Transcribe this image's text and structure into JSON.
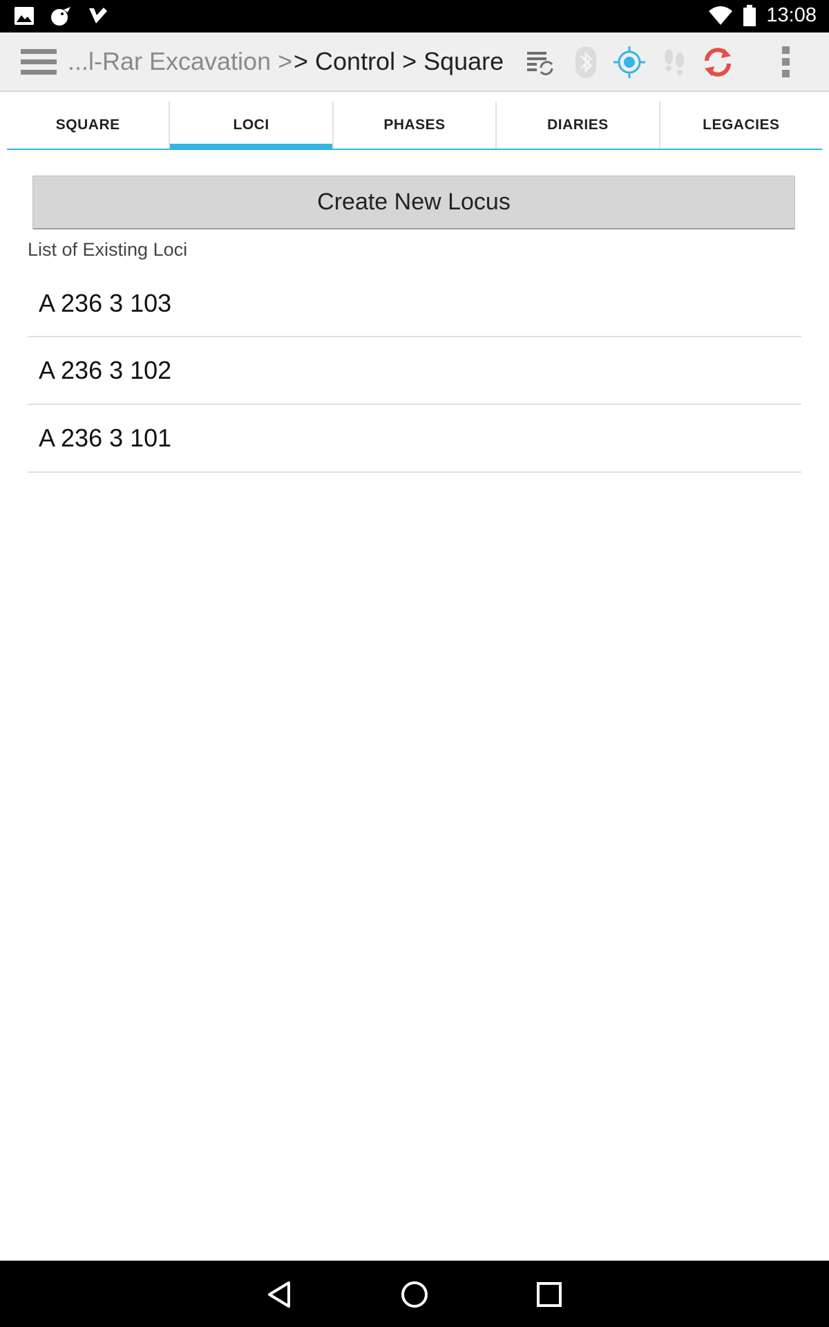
{
  "status_bar": {
    "time": "13:08",
    "left_icons": [
      "image-icon",
      "bird-icon",
      "check-icon"
    ],
    "right_icons": [
      "wifi-icon",
      "battery-icon"
    ]
  },
  "action_bar": {
    "breadcrumb_muted": "...l-Rar Excavation >",
    "breadcrumb_main": "> Control > Square",
    "icons": [
      "hamburger-icon",
      "sync-list-icon",
      "bluetooth-icon",
      "gps-icon",
      "footsteps-icon",
      "refresh-icon",
      "overflow-menu-icon"
    ]
  },
  "tabs": [
    {
      "label": "SQUARE",
      "active": false
    },
    {
      "label": "LOCI",
      "active": true
    },
    {
      "label": "PHASES",
      "active": false
    },
    {
      "label": "DIARIES",
      "active": false
    },
    {
      "label": "LEGACIES",
      "active": false
    }
  ],
  "main": {
    "create_button_label": "Create New Locus",
    "list_label": "List of Existing Loci",
    "loci": [
      "A 236 3 103",
      "A 236 3 102",
      "A 236 3 101"
    ]
  },
  "colors": {
    "accent": "#33b5e5",
    "refresh": "#e0504a",
    "status_bar": "#000000",
    "action_bar": "#efefef"
  },
  "nav_bar": {
    "icons": [
      "back-icon",
      "home-icon",
      "recents-icon"
    ]
  }
}
